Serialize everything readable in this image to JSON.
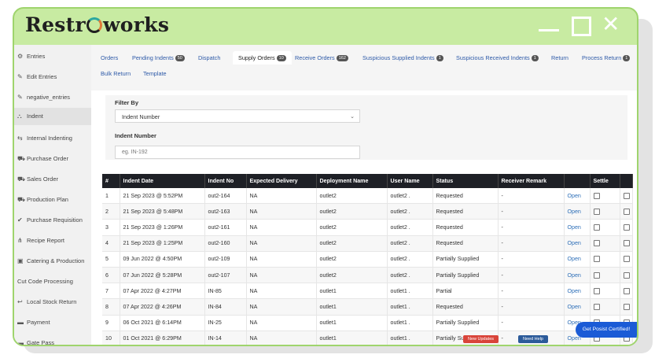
{
  "app": {
    "logo_text_a": "Restr",
    "logo_text_b": "works"
  },
  "window_controls": [
    "minimize-icon",
    "maximize-icon",
    "close-icon"
  ],
  "sidebar": {
    "items": [
      {
        "label": "Entries",
        "icon": "entries-icon"
      },
      {
        "label": "Edit Entries",
        "icon": "edit-icon"
      },
      {
        "label": "negative_entries",
        "icon": "edit-icon"
      },
      {
        "label": "Indent",
        "icon": "indent-icon",
        "active": true
      },
      {
        "label": "Internal Indenting",
        "icon": "transfer-icon"
      },
      {
        "label": "Purchase Order",
        "icon": "cart-icon"
      },
      {
        "label": "Sales Order",
        "icon": "cart-icon"
      },
      {
        "label": "Production Plan",
        "icon": "cart-icon"
      },
      {
        "label": "Purchase Requisition",
        "icon": "check-icon"
      },
      {
        "label": "Recipe Report",
        "icon": "cutlery-icon"
      },
      {
        "label": "Catering & Production",
        "icon": "truck-icon"
      },
      {
        "label": "Cut Code Processing",
        "icon": ""
      },
      {
        "label": "Local Stock Return",
        "icon": "return-icon"
      },
      {
        "label": "Payment",
        "icon": "payment-icon"
      },
      {
        "label": "Gate Pass",
        "icon": "payment-icon"
      }
    ]
  },
  "tabs": [
    {
      "label": "Orders"
    },
    {
      "label": "Pending Indents",
      "badge": "50"
    },
    {
      "label": "Dispatch"
    },
    {
      "label": "Supply Orders",
      "badge": "10",
      "active": true
    },
    {
      "label": "Receive Orders",
      "badge": "162"
    },
    {
      "label": "Suspicious Supplied Indents",
      "badge": "1"
    },
    {
      "label": "Suspicious Received Indents",
      "badge": "1"
    },
    {
      "label": "Return"
    },
    {
      "label": "Process Return",
      "badge": "1"
    },
    {
      "label": "Bulk Return"
    },
    {
      "label": "Template"
    }
  ],
  "filter": {
    "filter_by_label": "Filter By",
    "filter_by_value": "Indent Number",
    "indent_number_label": "Indent Number",
    "indent_number_placeholder": "eg. IN-192"
  },
  "table": {
    "headers": [
      "#",
      "Indent Date",
      "Indent No",
      "Expected Delivery",
      "Deployment Name",
      "User Name",
      "Status",
      "Receiver Remark",
      "",
      "Settle",
      ""
    ],
    "rows": [
      [
        "1",
        "21 Sep 2023 @ 5:52PM",
        "out2-164",
        "NA",
        "outlet2",
        "outlet2 .",
        "Requested",
        "-",
        "Open"
      ],
      [
        "2",
        "21 Sep 2023 @ 5:48PM",
        "out2-163",
        "NA",
        "outlet2",
        "outlet2 .",
        "Requested",
        "-",
        "Open"
      ],
      [
        "3",
        "21 Sep 2023 @ 1:26PM",
        "out2-161",
        "NA",
        "outlet2",
        "outlet2 .",
        "Requested",
        "-",
        "Open"
      ],
      [
        "4",
        "21 Sep 2023 @ 1:25PM",
        "out2-160",
        "NA",
        "outlet2",
        "outlet2 .",
        "Requested",
        "-",
        "Open"
      ],
      [
        "5",
        "09 Jun 2022 @ 4:50PM",
        "out2-109",
        "NA",
        "outlet2",
        "outlet2 .",
        "Partially Supplied",
        "-",
        "Open"
      ],
      [
        "6",
        "07 Jun 2022 @ 5:28PM",
        "out2-107",
        "NA",
        "outlet2",
        "outlet2 .",
        "Partially Supplied",
        "-",
        "Open"
      ],
      [
        "7",
        "07 Apr 2022 @ 4:27PM",
        "IN-85",
        "NA",
        "outlet1",
        "outlet1 .",
        "Partial",
        "-",
        "Open"
      ],
      [
        "8",
        "07 Apr 2022 @ 4:26PM",
        "IN-84",
        "NA",
        "outlet1",
        "outlet1 .",
        "Requested",
        "-",
        "Open"
      ],
      [
        "9",
        "06 Oct 2021 @ 6:14PM",
        "IN-25",
        "NA",
        "outlet1",
        "outlet1 .",
        "Partially Supplied",
        "-",
        "Open"
      ],
      [
        "10",
        "01 Oct 2021 @ 6:29PM",
        "IN-14",
        "NA",
        "outlet1",
        "outlet1 .",
        "Partially Supplied",
        "-",
        "Open"
      ]
    ]
  },
  "floating": {
    "new_updates": "New Updates",
    "need_help": "Need Help",
    "certified": "Get Posist Certified!"
  },
  "colors": {
    "accent_green": "#c8eba2",
    "header_dark": "#1e2026",
    "link_blue": "#2e6fb8",
    "cta_blue": "#1b5bd6",
    "updates_red": "#d9443a",
    "help_blue": "#2c5b9a"
  }
}
